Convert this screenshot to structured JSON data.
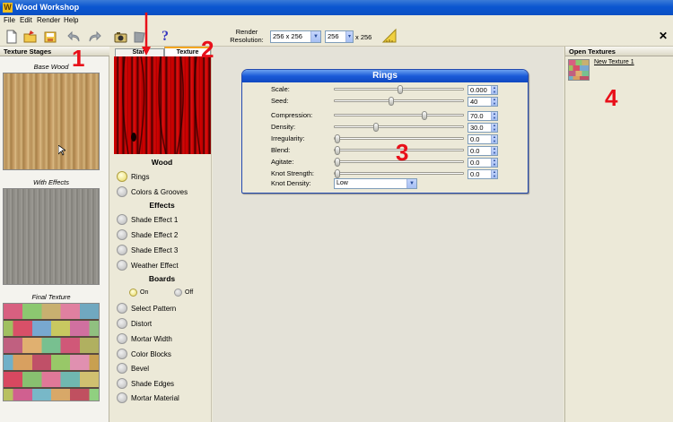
{
  "app": {
    "title": "Wood Workshop",
    "icon_letter": "W"
  },
  "menu": [
    "File",
    "Edit",
    "Render",
    "Help"
  ],
  "toolbar": {
    "icons": [
      "new-file-icon",
      "open-folder-icon",
      "save-icon",
      "undo-icon",
      "redo-icon",
      "render-camera-icon",
      "flag-icon",
      "help-icon"
    ],
    "help_glyph": "?",
    "render_resolution_label": "Render Resolution:",
    "resolution_select": "256 x 256",
    "width_value": "256",
    "height_label": "x 256",
    "close_glyph": "✕"
  },
  "texture_stages": {
    "header": "Texture Stages",
    "stages": [
      "Base Wood",
      "With Effects",
      "Final Texture"
    ]
  },
  "tabs": [
    "Start",
    "Texture"
  ],
  "wood_section": {
    "title": "Wood",
    "items": [
      "Rings",
      "Colors & Grooves"
    ]
  },
  "effects_section": {
    "title": "Effects",
    "items": [
      "Shade Effect 1",
      "Shade Effect 2",
      "Shade Effect 3",
      "Weather Effect"
    ]
  },
  "boards_section": {
    "title": "Boards",
    "on_label": "On",
    "off_label": "Off",
    "items": [
      "Select Pattern",
      "Distort",
      "Mortar Width",
      "Color Blocks",
      "Bevel",
      "Shade Edges",
      "Mortar Material"
    ]
  },
  "rings_panel": {
    "title": "Rings",
    "params": [
      {
        "label": "Scale:",
        "value": "0.000",
        "level": 0.5
      },
      {
        "label": "Seed:",
        "value": "40",
        "level": 0.43
      },
      {
        "label": "Compression:",
        "value": "70.0",
        "level": 0.7
      },
      {
        "label": "Density:",
        "value": "30.0",
        "level": 0.31
      },
      {
        "label": "Irregularity:",
        "value": "0.0",
        "level": 0.0
      },
      {
        "label": "Blend:",
        "value": "0.0",
        "level": 0.0
      },
      {
        "label": "Agitate:",
        "value": "0.0",
        "level": 0.0
      },
      {
        "label": "Knot Strength:",
        "value": "0.0",
        "level": 0.0
      }
    ],
    "knot_density_label": "Knot Density:",
    "knot_density_value": "Low"
  },
  "open_textures": {
    "header": "Open Textures",
    "items": [
      "New Texture 1"
    ]
  },
  "annotations": [
    "1",
    "2",
    "3",
    "4"
  ],
  "colors": {
    "accent_red": "#e8101a",
    "titlebar_blue": "#0b56d0"
  }
}
